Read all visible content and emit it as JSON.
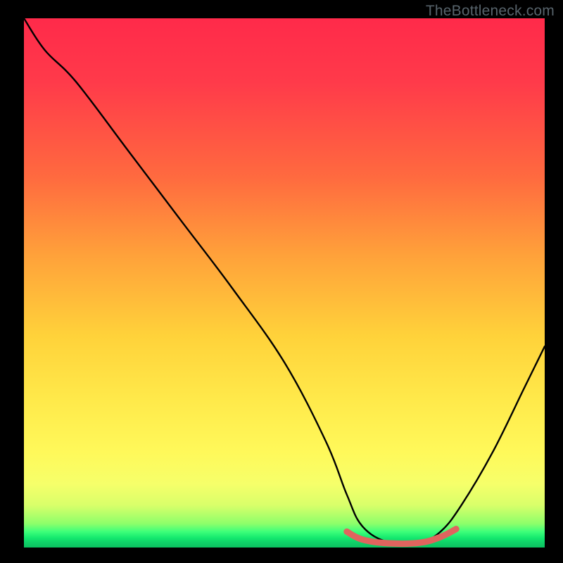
{
  "watermark": "TheBottleneck.com",
  "chart_data": {
    "type": "line",
    "title": "",
    "xlabel": "",
    "ylabel": "",
    "xlim": [
      0,
      100
    ],
    "ylim": [
      0,
      100
    ],
    "grid": false,
    "legend": false,
    "series": [
      {
        "name": "main-curve",
        "color": "#000000",
        "x": [
          0,
          4,
          10,
          20,
          30,
          40,
          50,
          58,
          62,
          65,
          70,
          76,
          80,
          84,
          90,
          96,
          100
        ],
        "y": [
          100,
          94,
          88,
          75,
          62,
          49,
          35,
          20,
          10,
          4,
          1,
          1,
          3,
          8,
          18,
          30,
          38
        ]
      },
      {
        "name": "highlight-segment",
        "color": "#e0645e",
        "x": [
          62,
          65,
          70,
          76,
          80,
          83
        ],
        "y": [
          3,
          1.5,
          0.8,
          0.9,
          2.0,
          3.5
        ]
      }
    ],
    "gradient_stops": [
      {
        "pos": 0,
        "color": "#ff2a4a"
      },
      {
        "pos": 0.45,
        "color": "#ffa23a"
      },
      {
        "pos": 0.82,
        "color": "#fff95a"
      },
      {
        "pos": 0.97,
        "color": "#3dff7a"
      },
      {
        "pos": 1.0,
        "color": "#0cc060"
      }
    ]
  }
}
